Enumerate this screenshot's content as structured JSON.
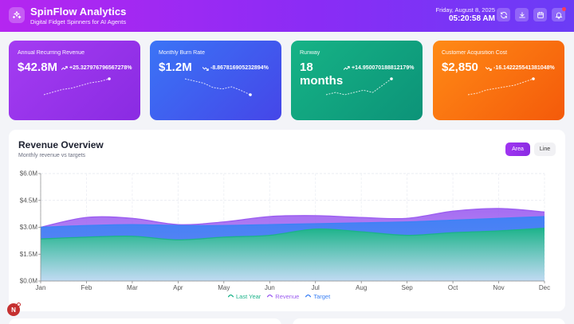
{
  "header": {
    "title": "SpinFlow Analytics",
    "subtitle": "Digital Fidget Spinners for AI Agents",
    "date": "Friday, August 8, 2025",
    "time": "05:20:58 AM",
    "buttons": [
      "refresh-icon",
      "download-icon",
      "calendar-icon",
      "bell-icon"
    ]
  },
  "kpis": [
    {
      "label": "Annual Recurring Revenue",
      "value": "$42.8M",
      "change": "+25.327976796567278%",
      "trend": "up",
      "spark": [
        2,
        2.2,
        2.4,
        2.5,
        2.7,
        2.9,
        3.0,
        3.2
      ]
    },
    {
      "label": "Monthly Burn Rate",
      "value": "$1.2M",
      "change": "-8.867816905232894%",
      "trend": "down",
      "spark": [
        3.6,
        3.3,
        3.0,
        2.4,
        2.2,
        2.5,
        2.0,
        1.4
      ]
    },
    {
      "label": "Runway",
      "value": "18 months",
      "change": "+14.950070188812179%",
      "trend": "up",
      "spark": [
        1.6,
        1.7,
        1.6,
        1.7,
        1.8,
        1.7,
        2.0,
        2.3
      ]
    },
    {
      "label": "Customer Acquisition Cost",
      "value": "$2,850",
      "change": "-16.142225541381048%",
      "trend": "down",
      "spark": [
        2.0,
        2.1,
        2.3,
        2.4,
        2.5,
        2.6,
        2.8,
        3.0
      ]
    }
  ],
  "panel": {
    "title": "Revenue Overview",
    "subtitle": "Monthly revenue vs targets",
    "toggle_area": "Area",
    "toggle_line": "Line"
  },
  "chart_data": {
    "type": "area",
    "categories": [
      "Jan",
      "Feb",
      "Mar",
      "Apr",
      "May",
      "Jun",
      "Jul",
      "Aug",
      "Sep",
      "Oct",
      "Nov",
      "Dec"
    ],
    "series": [
      {
        "name": "Last Year",
        "color": "#1db38a",
        "values": [
          2.35,
          2.45,
          2.5,
          2.3,
          2.45,
          2.55,
          2.9,
          2.75,
          2.55,
          2.7,
          2.8,
          2.95
        ]
      },
      {
        "name": "Revenue",
        "color": "#9b5cf0",
        "values": [
          3.0,
          3.55,
          3.5,
          3.15,
          3.3,
          3.6,
          3.65,
          3.55,
          3.5,
          3.9,
          4.05,
          3.85
        ]
      },
      {
        "name": "Target",
        "color": "#3d82f5",
        "values": [
          3.0,
          3.1,
          3.15,
          3.1,
          3.1,
          3.15,
          3.2,
          3.25,
          3.3,
          3.4,
          3.5,
          3.6
        ]
      }
    ],
    "y_ticks": [
      "$0.0M",
      "$1.5M",
      "$3.0M",
      "$4.5M",
      "$6.0M"
    ],
    "ylim": [
      0,
      6
    ],
    "grid": true,
    "legend": "bottom"
  },
  "fab": {
    "label": "N"
  }
}
